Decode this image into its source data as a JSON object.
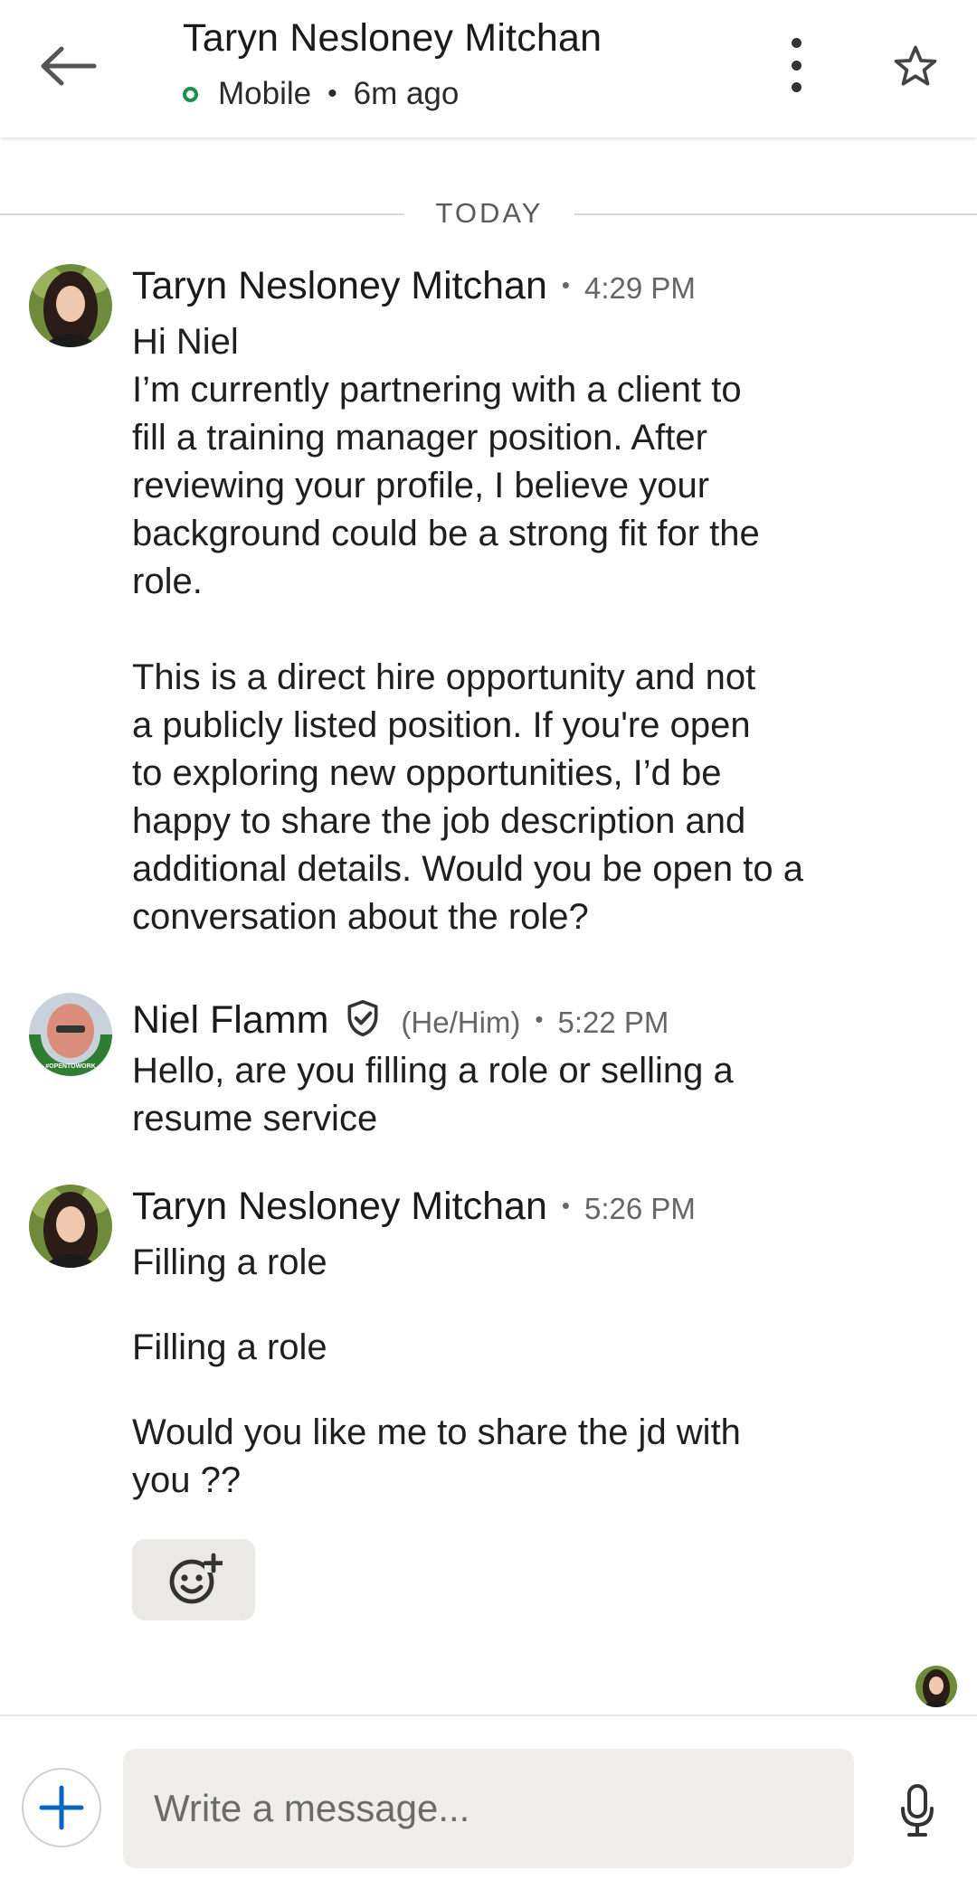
{
  "header": {
    "title": "Taryn Nesloney Mitchan",
    "status": "Mobile",
    "separator": "•",
    "last_active": "6m ago",
    "presence_color": "#1b8f4d"
  },
  "day_divider": "TODAY",
  "messages": [
    {
      "sender": "Taryn Nesloney Mitchan",
      "separator": "•",
      "time": "4:29 PM",
      "body": "Hi Niel\nI’m currently partnering with a client to\nfill a training manager position. After\nreviewing your profile, I believe your\nbackground could be a strong fit for the\nrole.\n\nThis is a direct hire opportunity and not\na publicly listed position. If you're open\nto exploring new opportunities, I’d be\nhappy to share the job description and\nadditional details. Would you be open to a\nconversation about the role?"
    },
    {
      "sender": "Niel Flamm",
      "pronouns": "(He/Him)",
      "separator": "•",
      "time": "5:22 PM",
      "badge_text": "#OPENTOWORK",
      "body": "Hello, are you filling a role or selling a\nresume service"
    },
    {
      "sender": "Taryn Nesloney Mitchan",
      "separator": "•",
      "time": "5:26 PM",
      "body_lines": [
        "Filling a role",
        "Filling a role",
        "Would you like me to share the jd with\nyou ??"
      ]
    }
  ],
  "compose": {
    "placeholder": "Write a message..."
  },
  "icons": {
    "back": "arrow-left-icon",
    "more": "kebab-menu-icon",
    "star": "star-outline-icon",
    "verify": "verified-shield-icon",
    "reaction": "add-reaction-icon",
    "add": "plus-icon",
    "mic": "microphone-icon"
  },
  "colors": {
    "accent": "#0a66c2",
    "open_to_work": "#2f7d32"
  }
}
